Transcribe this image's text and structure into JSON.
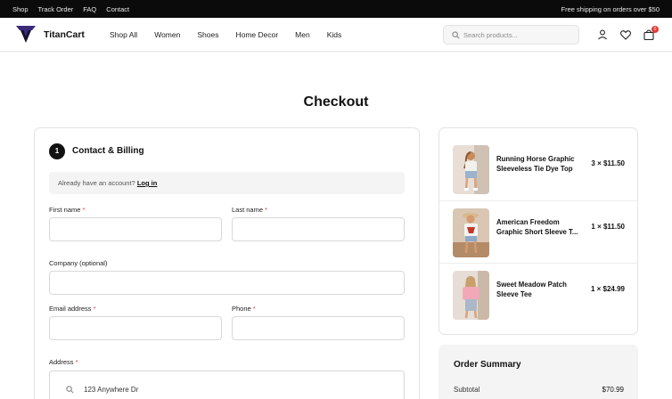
{
  "topbar": {
    "links": [
      "Shop",
      "Track Order",
      "FAQ",
      "Contact"
    ],
    "shipping": "Free shipping on orders over $50"
  },
  "header": {
    "brand": "TitanCart",
    "nav": [
      "Shop All",
      "Women",
      "Shoes",
      "Home Decor",
      "Men",
      "Kids"
    ],
    "search_placeholder": "Search products...",
    "cart_count": "0",
    "icons": [
      "search-icon",
      "user-icon",
      "heart-icon",
      "bag-icon"
    ],
    "accent": "#3b2a7a"
  },
  "page": {
    "title": "Checkout"
  },
  "checkout": {
    "step_number": "1",
    "step_title": "Contact & Billing",
    "login_prompt": "Already have an account?",
    "login_link": "Log in",
    "fields": {
      "first_name": "First name",
      "last_name": "Last name",
      "company": "Company (optional)",
      "email": "Email address",
      "phone": "Phone",
      "address": "Address",
      "required_mark": "*"
    },
    "address_value": "123 Anywhere Dr"
  },
  "cart": {
    "items": [
      {
        "name": "Running Horse Graphic Sleeveless Tie Dye Top",
        "qty_price": "3 × $11.50"
      },
      {
        "name": "American Freedom Graphic Short Sleeve T...",
        "qty_price": "1 × $11.50"
      },
      {
        "name": "Sweet Meadow Patch Sleeve Tee",
        "qty_price": "1 × $24.99"
      }
    ]
  },
  "summary": {
    "title": "Order Summary",
    "subtotal_label": "Subtotal",
    "subtotal_value": "$70.99"
  }
}
